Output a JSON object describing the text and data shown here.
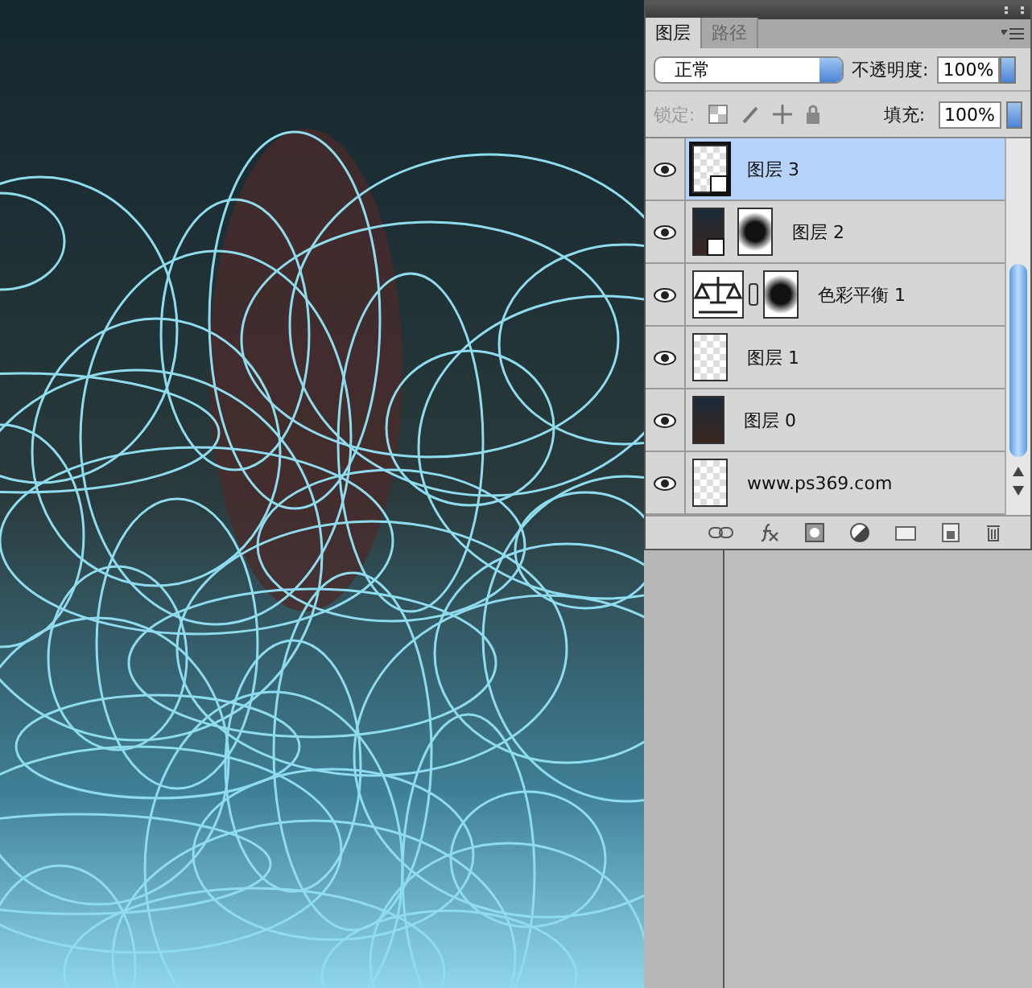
{
  "layers_panel": {
    "tabs": [
      {
        "label": "图层",
        "selected": true
      },
      {
        "label": "路径",
        "selected": false
      }
    ],
    "blend_mode": "正常",
    "opacity_label": "不透明度:",
    "opacity": "100%",
    "lock_label": "锁定:",
    "fill_label": "填充:",
    "fill": "100%",
    "layers": [
      {
        "name": "图层 3",
        "visible": true,
        "selected": true,
        "kind": "transparent",
        "smart": true,
        "mask": false
      },
      {
        "name": "图层 2",
        "visible": true,
        "selected": false,
        "kind": "photo",
        "smart": true,
        "mask": true
      },
      {
        "name": "色彩平衡 1",
        "visible": true,
        "selected": false,
        "kind": "balance",
        "smart": false,
        "mask": true
      },
      {
        "name": "图层 1",
        "visible": true,
        "selected": false,
        "kind": "transparent",
        "smart": false,
        "mask": false
      },
      {
        "name": "图层 0",
        "visible": true,
        "selected": false,
        "kind": "photo",
        "smart": false,
        "mask": false
      },
      {
        "name": "www.ps369.com",
        "visible": true,
        "selected": false,
        "kind": "transparent",
        "smart": false,
        "mask": false
      }
    ]
  }
}
